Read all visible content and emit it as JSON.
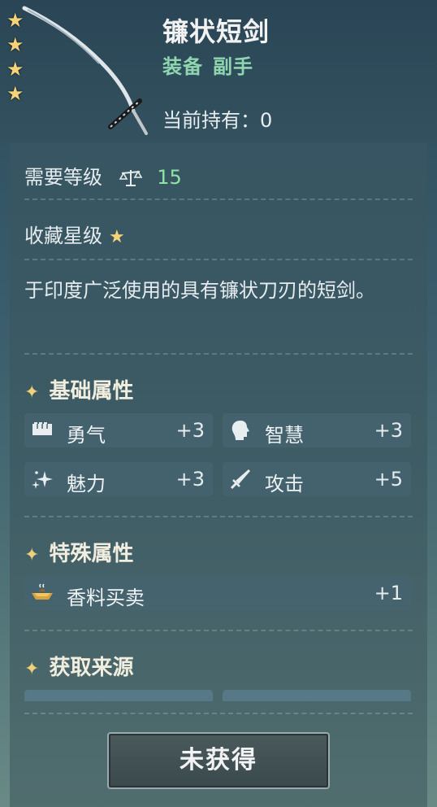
{
  "item": {
    "name": "镰状短剑",
    "category": "装备",
    "subcategory": "副手",
    "stars": 4,
    "owned_label": "当前持有：",
    "owned_value": "0"
  },
  "details": {
    "level_label": "需要等级",
    "level_value": "15",
    "collect_label": "收藏星级",
    "description": "于印度广泛使用的具有镰状刀刃的短剑。"
  },
  "basic": {
    "title": "基础属性",
    "attrs": [
      {
        "icon": "fist-icon",
        "label": "勇气",
        "value": "+3"
      },
      {
        "icon": "head-icon",
        "label": "智慧",
        "value": "+3"
      },
      {
        "icon": "sparkle-icon",
        "label": "魅力",
        "value": "+3"
      },
      {
        "icon": "sword-icon",
        "label": "攻击",
        "value": "+5"
      }
    ]
  },
  "special": {
    "title": "特殊属性",
    "attrs": [
      {
        "icon": "spice-bowl-icon",
        "label": "香料买卖",
        "value": "+1"
      }
    ]
  },
  "source": {
    "title": "获取来源"
  },
  "action": {
    "button_label": "未获得"
  },
  "colors": {
    "accent_green": "#8fd6b0",
    "level_green": "#8fe3a6",
    "star_gold": "#f4d37a"
  }
}
